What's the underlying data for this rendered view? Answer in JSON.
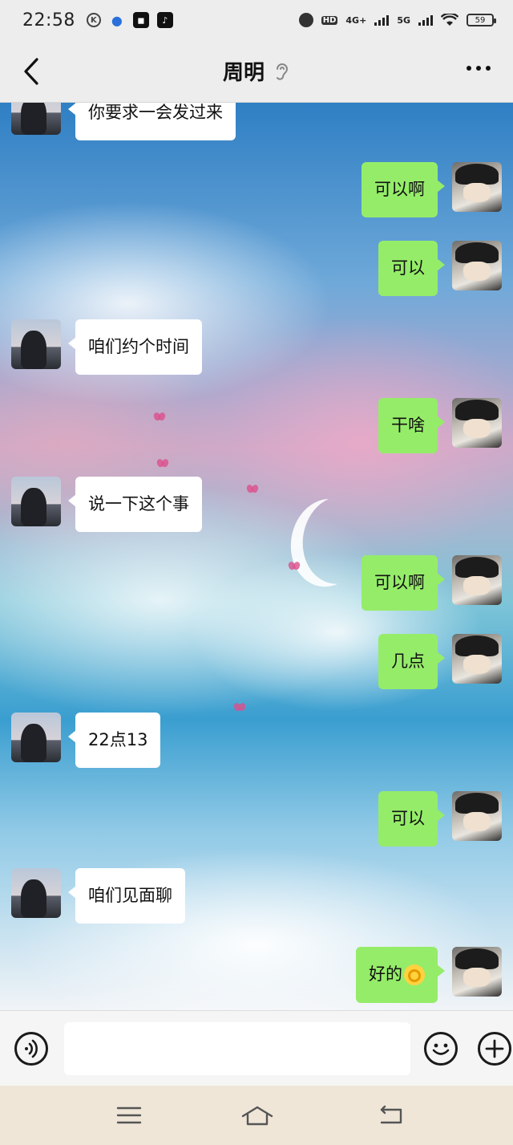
{
  "status_bar": {
    "time": "22:58",
    "icons_left": [
      "k-icon",
      "paw-icon",
      "app-icon",
      "tiktok-icon"
    ],
    "hd_label": "HD",
    "net_4g": "4G+",
    "net_5g": "5G",
    "battery": "59"
  },
  "header": {
    "title": "周明"
  },
  "messages": [
    {
      "side": "left",
      "text": "你要求一会发过来"
    },
    {
      "side": "right",
      "text": "可以啊"
    },
    {
      "side": "right",
      "text": "可以"
    },
    {
      "side": "left",
      "text": "咱们约个时间"
    },
    {
      "side": "right",
      "text": "干啥"
    },
    {
      "side": "left",
      "text": "说一下这个事"
    },
    {
      "side": "right",
      "text": "可以啊"
    },
    {
      "side": "right",
      "text": "几点"
    },
    {
      "side": "left",
      "text": "22点13"
    },
    {
      "side": "right",
      "text": "可以"
    },
    {
      "side": "left",
      "text": "咱们见面聊"
    },
    {
      "side": "right",
      "text": "好的",
      "emoji": "ok-hand-emoji"
    }
  ],
  "input": {
    "value": "",
    "placeholder": ""
  },
  "colors": {
    "bubble_mine": "#95ec69",
    "bubble_theirs": "#ffffff",
    "header_bg": "#ededed",
    "nav_bg": "#efe6d8"
  }
}
